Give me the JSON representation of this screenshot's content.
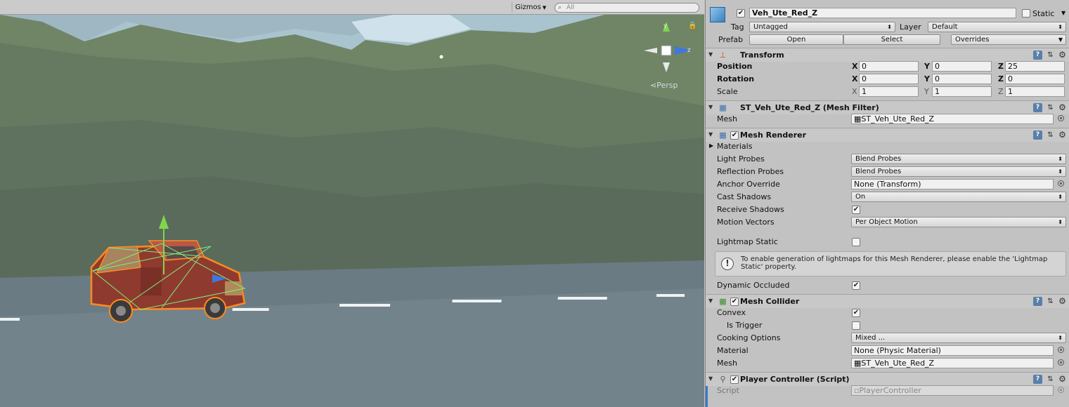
{
  "scene": {
    "gizmos_label": "Gizmos",
    "search_placeholder": "All",
    "projection_label": "Persp",
    "axes": {
      "y": "y",
      "z": "z"
    }
  },
  "inspector": {
    "object": {
      "name": "Veh_Ute_Red_Z",
      "active": true,
      "static_label": "Static",
      "static": false,
      "tag_label": "Tag",
      "tag_value": "Untagged",
      "layer_label": "Layer",
      "layer_value": "Default",
      "prefab_label": "Prefab",
      "open_label": "Open",
      "select_label": "Select",
      "overrides_label": "Overrides"
    },
    "transform": {
      "title": "Transform",
      "position_label": "Position",
      "rotation_label": "Rotation",
      "scale_label": "Scale",
      "position": {
        "x": "0",
        "y": "0",
        "z": "25"
      },
      "rotation": {
        "x": "0",
        "y": "0",
        "z": "0"
      },
      "scale": {
        "x": "1",
        "y": "1",
        "z": "1"
      }
    },
    "mesh_filter": {
      "title": "ST_Veh_Ute_Red_Z (Mesh Filter)",
      "mesh_label": "Mesh",
      "mesh_value": "ST_Veh_Ute_Red_Z"
    },
    "mesh_renderer": {
      "title": "Mesh Renderer",
      "enabled": true,
      "materials_label": "Materials",
      "light_probes_label": "Light Probes",
      "light_probes_value": "Blend Probes",
      "reflection_probes_label": "Reflection Probes",
      "reflection_probes_value": "Blend Probes",
      "anchor_override_label": "Anchor Override",
      "anchor_override_value": "None (Transform)",
      "cast_shadows_label": "Cast Shadows",
      "cast_shadows_value": "On",
      "receive_shadows_label": "Receive Shadows",
      "receive_shadows": true,
      "motion_vectors_label": "Motion Vectors",
      "motion_vectors_value": "Per Object Motion",
      "lightmap_static_label": "Lightmap Static",
      "lightmap_static": false,
      "lightmap_help": "To enable generation of lightmaps for this Mesh Renderer, please enable the 'Lightmap Static' property.",
      "dynamic_occluded_label": "Dynamic Occluded",
      "dynamic_occluded": true
    },
    "mesh_collider": {
      "title": "Mesh Collider",
      "enabled": true,
      "convex_label": "Convex",
      "convex": true,
      "is_trigger_label": "Is Trigger",
      "is_trigger": false,
      "cooking_options_label": "Cooking Options",
      "cooking_options_value": "Mixed ...",
      "material_label": "Material",
      "material_value": "None (Physic Material)",
      "mesh_label": "Mesh",
      "mesh_value": "ST_Veh_Ute_Red_Z"
    },
    "player_controller": {
      "title": "Player Controller (Script)",
      "enabled": true,
      "script_label": "Script",
      "script_value": "PlayerController"
    }
  }
}
